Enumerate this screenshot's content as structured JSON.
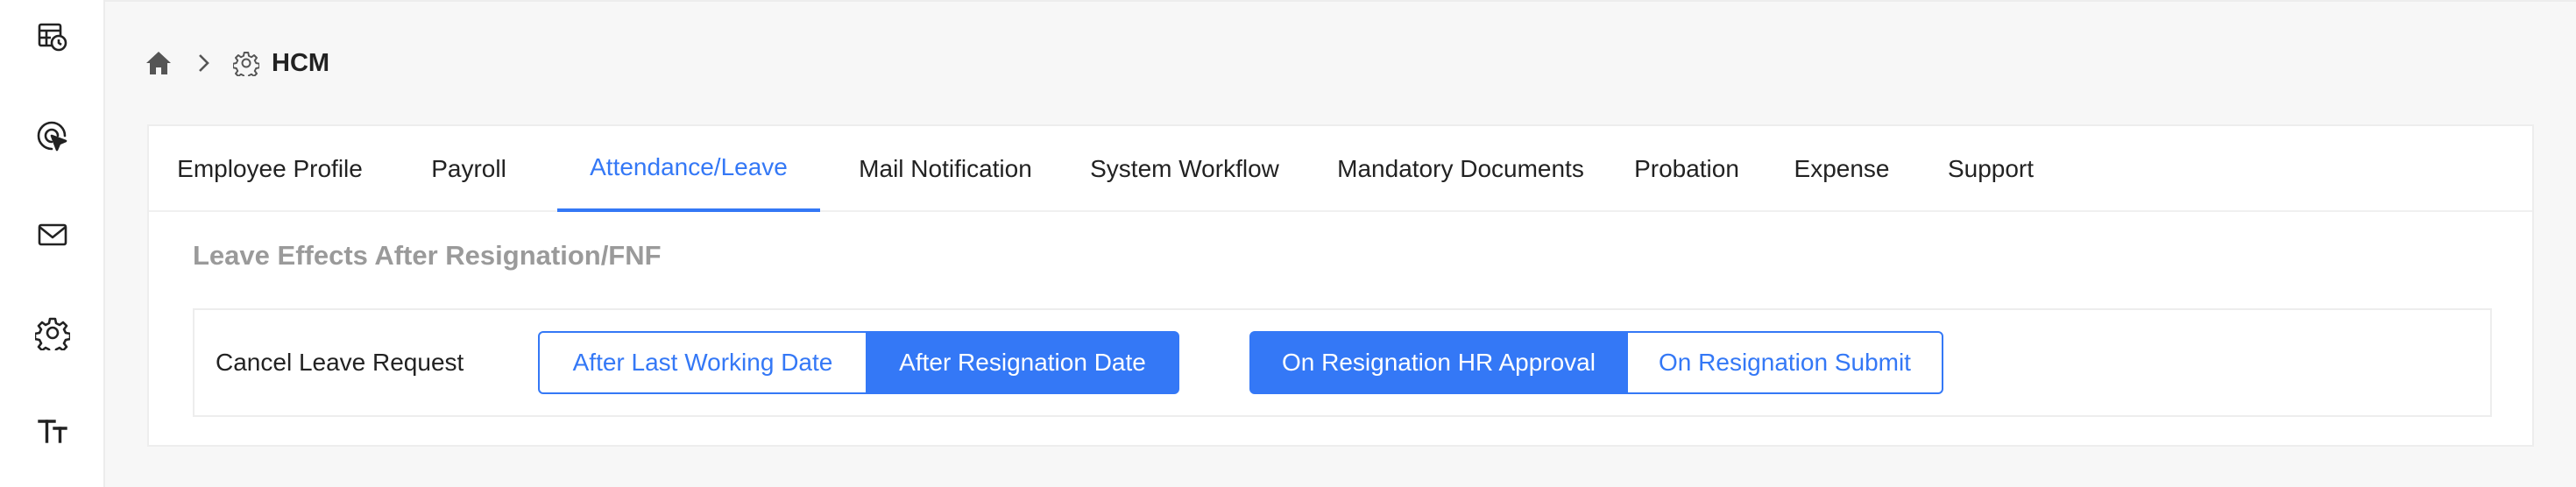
{
  "sidebar": {
    "items": [
      {
        "icon": "table-clock-icon"
      },
      {
        "icon": "target-cursor-icon"
      },
      {
        "icon": "mail-icon"
      },
      {
        "icon": "gear-icon"
      },
      {
        "icon": "text-size-icon"
      }
    ]
  },
  "breadcrumb": {
    "home_icon": "home-icon",
    "separator_icon": "chevron-right-icon",
    "section_icon": "gear-icon",
    "label": "HCM"
  },
  "tabs": [
    {
      "label": "Employee Profile",
      "active": false
    },
    {
      "label": "Payroll",
      "active": false
    },
    {
      "label": "Attendance/Leave",
      "active": true
    },
    {
      "label": "Mail Notification",
      "active": false
    },
    {
      "label": "System Workflow",
      "active": false
    },
    {
      "label": "Mandatory Documents",
      "active": false
    },
    {
      "label": "Probation",
      "active": false
    },
    {
      "label": "Expense",
      "active": false
    },
    {
      "label": "Support",
      "active": false
    }
  ],
  "section": {
    "title": "Leave Effects After Resignation/FNF",
    "row": {
      "label": "Cancel Leave Request",
      "group1": {
        "options": [
          "After Last Working Date",
          "After Resignation Date"
        ],
        "selected": "After Resignation Date"
      },
      "group2": {
        "options": [
          "On Resignation HR Approval",
          "On Resignation Submit"
        ],
        "selected": "On Resignation HR Approval"
      }
    }
  },
  "colors": {
    "accent": "#3478f6",
    "muted_title": "#9a9a9a",
    "text": "#222222",
    "background": "#f7f7f7"
  }
}
